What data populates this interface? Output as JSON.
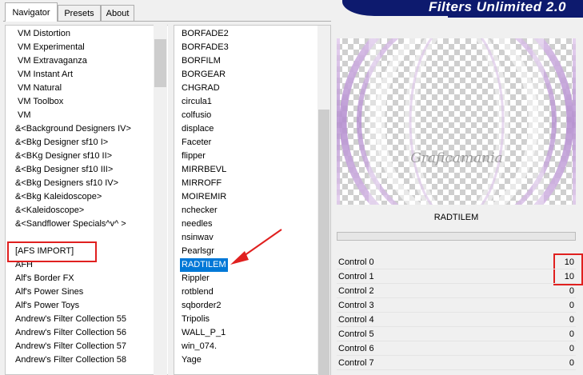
{
  "tabs": [
    {
      "label": "Navigator",
      "active": true
    },
    {
      "label": "Presets",
      "active": false
    },
    {
      "label": "About",
      "active": false
    }
  ],
  "banner_title": "Filters Unlimited 2.0",
  "categories": [
    "VM Distortion",
    "VM Experimental",
    "VM Extravaganza",
    "VM Instant Art",
    "VM Natural",
    "VM Toolbox",
    "VM",
    "&<Background Designers IV>",
    "&<Bkg Designer sf10 I>",
    "&<BKg Designer sf10 II>",
    "&<Bkg Designer sf10 III>",
    "&<Bkg Designers sf10 IV>",
    "&<Bkg Kaleidoscope>",
    "&<Kaleidoscope>",
    "&<Sandflower Specials^v^ >",
    "",
    "[AFS IMPORT]",
    "AFH",
    "Alf's Border FX",
    "Alf's Power Sines",
    "Alf's Power Toys",
    "Andrew's Filter Collection 55",
    "Andrew's Filter Collection 56",
    "Andrew's Filter Collection 57",
    "Andrew's Filter Collection 58"
  ],
  "filters": [
    "BORFADE2",
    "BORFADE3",
    "BORFILM",
    "BORGEAR",
    "CHGRAD",
    "circula1",
    "colfusio",
    "displace",
    "Faceter",
    "flipper",
    "MIRRBEVL",
    "MIRROFF",
    "MOIREMIR",
    "nchecker",
    "needles",
    "nsinwav",
    "Pearlsgr",
    "RADTILEM",
    "Rippler",
    "rotblend",
    "sqborder2",
    "Tripolis",
    "WALL_P_1",
    "win_074.",
    "Yage"
  ],
  "selected_filter": "RADTILEM",
  "preview_watermark": "Graficamania",
  "filter_name_label": "RADTILEM",
  "controls": [
    {
      "label": "Control 0",
      "value": "10"
    },
    {
      "label": "Control 1",
      "value": "10"
    },
    {
      "label": "Control 2",
      "value": "0"
    },
    {
      "label": "Control 3",
      "value": "0"
    },
    {
      "label": "Control 4",
      "value": "0"
    },
    {
      "label": "Control 5",
      "value": "0"
    },
    {
      "label": "Control 6",
      "value": "0"
    },
    {
      "label": "Control 7",
      "value": "0"
    }
  ],
  "colors": {
    "selection": "#0078d7",
    "highlight_box": "#e0201f",
    "banner": "#0d1a6e",
    "preview_purple": "#b58fd0"
  }
}
